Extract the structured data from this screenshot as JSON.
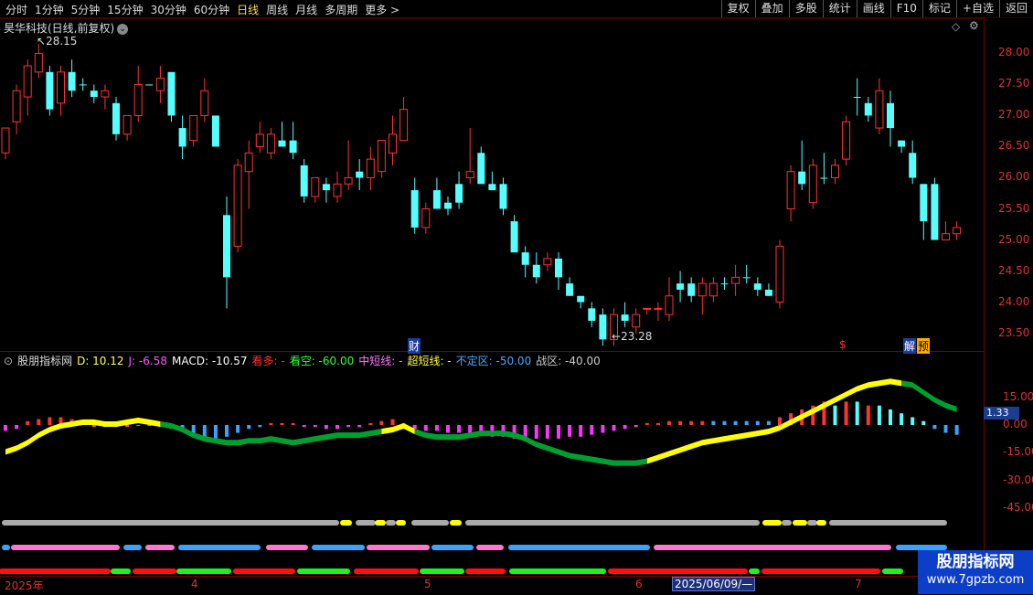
{
  "toolbar": {
    "periods": [
      "分时",
      "1分钟",
      "5分钟",
      "15分钟",
      "30分钟",
      "60分钟",
      "日线",
      "周线",
      "月线",
      "多周期",
      "更多 >"
    ],
    "active_period": "日线",
    "right_buttons": [
      "复权",
      "叠加",
      "多股",
      "统计",
      "画线",
      "F10",
      "标记",
      "+自选",
      "返回"
    ]
  },
  "header": {
    "title": "昊华科技(日线,前复权)",
    "icon_right": "diamond-icon"
  },
  "price_axis": [
    "28.00",
    "27.50",
    "27.00",
    "26.50",
    "26.00",
    "25.50",
    "25.00",
    "24.50",
    "24.00",
    "23.50"
  ],
  "annotations": {
    "high": "28.15",
    "low": "23.28",
    "cai": "财",
    "dollar": "$",
    "jie": "解",
    "yu": "预"
  },
  "indicator": {
    "name": "股朋指标网",
    "d": "D: 10.12",
    "j": "J: -6.58",
    "macd": "MACD: -10.57",
    "kanduo": "看多: -",
    "kankong": "看空: -60.00",
    "zhongduan": "中短线: -",
    "chaoduan": "超短线: -",
    "buding": "不定区: -50.00",
    "zhanqu": "战区: -40.00",
    "axis": [
      "15.00",
      "0.00",
      "-15.00",
      "-30.00",
      "-45.00"
    ],
    "current": "1.33"
  },
  "dates": [
    "2025年",
    "4",
    "5",
    "6",
    "7"
  ],
  "selected_date": "2025/06/09/—",
  "watermark": {
    "line1": "股朋指标网",
    "line2": "www.7gpzb.com"
  },
  "colors": {
    "up": "#ff3232",
    "down": "#54ffff",
    "axis": "#e03030",
    "yellow": "#ffff00",
    "green": "#00a030"
  },
  "chart_data": {
    "type": "candlestick",
    "title": "昊华科技(日线,前复权)",
    "ylim": [
      23.2,
      28.3
    ],
    "candles": [
      {
        "o": 26.4,
        "h": 26.8,
        "l": 26.3,
        "c": 26.8,
        "u": 1
      },
      {
        "o": 26.9,
        "h": 27.5,
        "l": 26.7,
        "c": 27.4,
        "u": 1
      },
      {
        "o": 27.3,
        "h": 27.9,
        "l": 27.0,
        "c": 27.8,
        "u": 1
      },
      {
        "o": 27.7,
        "h": 28.15,
        "l": 27.6,
        "c": 28.0,
        "u": 1
      },
      {
        "o": 27.7,
        "h": 27.8,
        "l": 27.0,
        "c": 27.1,
        "u": 0
      },
      {
        "o": 27.2,
        "h": 27.8,
        "l": 27.0,
        "c": 27.7,
        "u": 1
      },
      {
        "o": 27.7,
        "h": 27.9,
        "l": 27.3,
        "c": 27.4,
        "u": 0
      },
      {
        "o": 27.5,
        "h": 27.6,
        "l": 27.4,
        "c": 27.5,
        "u": 0
      },
      {
        "o": 27.4,
        "h": 27.5,
        "l": 27.2,
        "c": 27.3,
        "u": 0
      },
      {
        "o": 27.3,
        "h": 27.5,
        "l": 27.1,
        "c": 27.4,
        "u": 1
      },
      {
        "o": 27.2,
        "h": 27.3,
        "l": 26.6,
        "c": 26.7,
        "u": 0
      },
      {
        "o": 26.7,
        "h": 27.0,
        "l": 26.6,
        "c": 27.0,
        "u": 1
      },
      {
        "o": 27.0,
        "h": 27.8,
        "l": 26.9,
        "c": 27.5,
        "u": 1
      },
      {
        "o": 27.5,
        "h": 27.5,
        "l": 27.5,
        "c": 27.5,
        "u": 0
      },
      {
        "o": 27.4,
        "h": 27.8,
        "l": 27.2,
        "c": 27.6,
        "u": 1
      },
      {
        "o": 27.7,
        "h": 27.7,
        "l": 26.9,
        "c": 27.0,
        "u": 0
      },
      {
        "o": 26.8,
        "h": 27.0,
        "l": 26.3,
        "c": 26.5,
        "u": 0
      },
      {
        "o": 26.6,
        "h": 27.0,
        "l": 26.5,
        "c": 27.0,
        "u": 1
      },
      {
        "o": 27.0,
        "h": 27.6,
        "l": 26.9,
        "c": 27.4,
        "u": 1
      },
      {
        "o": 26.5,
        "h": 27.0,
        "l": 26.5,
        "c": 27.0,
        "u": 0
      },
      {
        "o": 24.4,
        "h": 25.7,
        "l": 23.9,
        "c": 25.4,
        "u": 0
      },
      {
        "o": 24.9,
        "h": 26.3,
        "l": 24.8,
        "c": 26.2,
        "u": 1
      },
      {
        "o": 26.1,
        "h": 26.6,
        "l": 25.5,
        "c": 26.4,
        "u": 1
      },
      {
        "o": 26.5,
        "h": 26.9,
        "l": 26.4,
        "c": 26.7,
        "u": 1
      },
      {
        "o": 26.7,
        "h": 26.8,
        "l": 26.3,
        "c": 26.4,
        "u": 1
      },
      {
        "o": 26.6,
        "h": 26.9,
        "l": 26.5,
        "c": 26.5,
        "u": 0
      },
      {
        "o": 26.6,
        "h": 26.9,
        "l": 26.3,
        "c": 26.4,
        "u": 0
      },
      {
        "o": 26.2,
        "h": 26.3,
        "l": 25.6,
        "c": 25.7,
        "u": 0
      },
      {
        "o": 25.7,
        "h": 26.0,
        "l": 25.6,
        "c": 26.0,
        "u": 1
      },
      {
        "o": 25.9,
        "h": 26.0,
        "l": 25.6,
        "c": 25.8,
        "u": 0
      },
      {
        "o": 25.7,
        "h": 26.1,
        "l": 25.6,
        "c": 25.9,
        "u": 1
      },
      {
        "o": 25.9,
        "h": 26.6,
        "l": 25.8,
        "c": 26.0,
        "u": 1
      },
      {
        "o": 26.1,
        "h": 26.3,
        "l": 25.8,
        "c": 26.0,
        "u": 0
      },
      {
        "o": 26.3,
        "h": 26.5,
        "l": 25.8,
        "c": 26.0,
        "u": 1
      },
      {
        "o": 26.6,
        "h": 26.6,
        "l": 26.0,
        "c": 26.1,
        "u": 1
      },
      {
        "o": 26.4,
        "h": 27.0,
        "l": 26.2,
        "c": 26.7,
        "u": 1
      },
      {
        "o": 27.1,
        "h": 27.3,
        "l": 26.6,
        "c": 26.6,
        "u": 1
      },
      {
        "o": 25.8,
        "h": 26.0,
        "l": 25.1,
        "c": 25.2,
        "u": 0
      },
      {
        "o": 25.2,
        "h": 25.6,
        "l": 25.1,
        "c": 25.5,
        "u": 1
      },
      {
        "o": 25.8,
        "h": 26.0,
        "l": 25.5,
        "c": 25.5,
        "u": 0
      },
      {
        "o": 25.6,
        "h": 25.7,
        "l": 25.4,
        "c": 25.5,
        "u": 0
      },
      {
        "o": 25.9,
        "h": 26.1,
        "l": 25.5,
        "c": 25.6,
        "u": 0
      },
      {
        "o": 26.0,
        "h": 26.8,
        "l": 25.9,
        "c": 26.1,
        "u": 1
      },
      {
        "o": 26.4,
        "h": 26.5,
        "l": 25.9,
        "c": 25.9,
        "u": 0
      },
      {
        "o": 25.9,
        "h": 26.1,
        "l": 25.8,
        "c": 25.8,
        "u": 0
      },
      {
        "o": 25.9,
        "h": 26.0,
        "l": 25.4,
        "c": 25.5,
        "u": 0
      },
      {
        "o": 25.3,
        "h": 25.4,
        "l": 24.8,
        "c": 24.8,
        "u": 0
      },
      {
        "o": 24.8,
        "h": 24.9,
        "l": 24.4,
        "c": 24.6,
        "u": 0
      },
      {
        "o": 24.6,
        "h": 24.8,
        "l": 24.3,
        "c": 24.4,
        "u": 0
      },
      {
        "o": 24.6,
        "h": 24.8,
        "l": 24.5,
        "c": 24.7,
        "u": 1
      },
      {
        "o": 24.7,
        "h": 24.8,
        "l": 24.2,
        "c": 24.4,
        "u": 0
      },
      {
        "o": 24.3,
        "h": 24.4,
        "l": 24.1,
        "c": 24.1,
        "u": 0
      },
      {
        "o": 24.1,
        "h": 24.1,
        "l": 23.9,
        "c": 24.0,
        "u": 0
      },
      {
        "o": 23.9,
        "h": 24.0,
        "l": 23.6,
        "c": 23.7,
        "u": 0
      },
      {
        "o": 23.8,
        "h": 23.9,
        "l": 23.3,
        "c": 23.4,
        "u": 0
      },
      {
        "o": 23.4,
        "h": 23.9,
        "l": 23.3,
        "c": 23.8,
        "u": 1
      },
      {
        "o": 23.8,
        "h": 24.0,
        "l": 23.6,
        "c": 23.7,
        "u": 0
      },
      {
        "o": 23.6,
        "h": 23.9,
        "l": 23.5,
        "c": 23.8,
        "u": 1
      },
      {
        "o": 23.9,
        "h": 23.9,
        "l": 23.8,
        "c": 23.9,
        "u": 1
      },
      {
        "o": 23.9,
        "h": 24.0,
        "l": 23.7,
        "c": 23.9,
        "u": 1
      },
      {
        "o": 23.8,
        "h": 24.4,
        "l": 23.7,
        "c": 24.1,
        "u": 1
      },
      {
        "o": 24.2,
        "h": 24.5,
        "l": 24.0,
        "c": 24.3,
        "u": 0
      },
      {
        "o": 24.3,
        "h": 24.4,
        "l": 24.0,
        "c": 24.1,
        "u": 0
      },
      {
        "o": 24.3,
        "h": 24.4,
        "l": 23.8,
        "c": 24.1,
        "u": 1
      },
      {
        "o": 24.1,
        "h": 24.4,
        "l": 24.0,
        "c": 24.3,
        "u": 1
      },
      {
        "o": 24.3,
        "h": 24.4,
        "l": 24.2,
        "c": 24.3,
        "u": 0
      },
      {
        "o": 24.3,
        "h": 24.6,
        "l": 24.1,
        "c": 24.4,
        "u": 1
      },
      {
        "o": 24.4,
        "h": 24.6,
        "l": 24.3,
        "c": 24.4,
        "u": 0
      },
      {
        "o": 24.3,
        "h": 24.4,
        "l": 24.1,
        "c": 24.2,
        "u": 0
      },
      {
        "o": 24.2,
        "h": 24.3,
        "l": 24.1,
        "c": 24.1,
        "u": 0
      },
      {
        "o": 24.0,
        "h": 25.0,
        "l": 23.9,
        "c": 24.9,
        "u": 1
      },
      {
        "o": 25.5,
        "h": 26.2,
        "l": 25.3,
        "c": 26.1,
        "u": 1
      },
      {
        "o": 26.1,
        "h": 26.6,
        "l": 25.8,
        "c": 25.9,
        "u": 0
      },
      {
        "o": 25.6,
        "h": 26.3,
        "l": 25.5,
        "c": 26.2,
        "u": 1
      },
      {
        "o": 26.0,
        "h": 26.4,
        "l": 25.9,
        "c": 26.0,
        "u": 0
      },
      {
        "o": 26.0,
        "h": 26.3,
        "l": 25.9,
        "c": 26.2,
        "u": 1
      },
      {
        "o": 26.3,
        "h": 27.0,
        "l": 26.2,
        "c": 26.9,
        "u": 1
      },
      {
        "o": 27.3,
        "h": 27.6,
        "l": 27.0,
        "c": 27.3,
        "u": 0
      },
      {
        "o": 27.2,
        "h": 27.3,
        "l": 26.9,
        "c": 27.0,
        "u": 0
      },
      {
        "o": 26.8,
        "h": 27.6,
        "l": 26.7,
        "c": 27.4,
        "u": 1
      },
      {
        "o": 27.2,
        "h": 27.4,
        "l": 26.5,
        "c": 26.8,
        "u": 0
      },
      {
        "o": 26.6,
        "h": 26.6,
        "l": 26.4,
        "c": 26.5,
        "u": 0
      },
      {
        "o": 26.4,
        "h": 26.6,
        "l": 25.9,
        "c": 26.0,
        "u": 0
      },
      {
        "o": 25.9,
        "h": 25.9,
        "l": 25.0,
        "c": 25.3,
        "u": 0
      },
      {
        "o": 25.9,
        "h": 26.0,
        "l": 25.0,
        "c": 25.0,
        "u": 0
      },
      {
        "o": 25.0,
        "h": 25.3,
        "l": 25.0,
        "c": 25.1,
        "u": 1
      },
      {
        "o": 25.1,
        "h": 25.3,
        "l": 25.0,
        "c": 25.2,
        "u": 1
      }
    ]
  }
}
